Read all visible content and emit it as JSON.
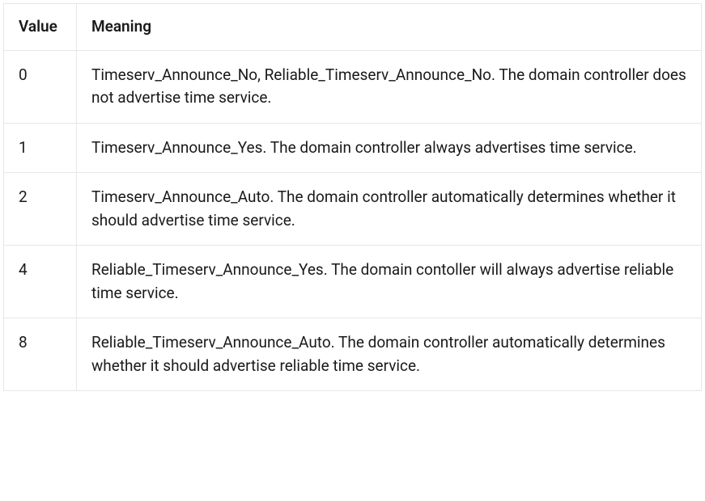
{
  "table": {
    "headers": {
      "value": "Value",
      "meaning": "Meaning"
    },
    "rows": [
      {
        "value": "0",
        "meaning": "Timeserv_Announce_No, Reliable_Timeserv_Announce_No. The domain controller does not advertise time service."
      },
      {
        "value": "1",
        "meaning": "Timeserv_Announce_Yes. The domain controller always advertises time service."
      },
      {
        "value": "2",
        "meaning": "Timeserv_Announce_Auto. The domain controller automatically determines whether it should advertise time service."
      },
      {
        "value": "4",
        "meaning": "Reliable_Timeserv_Announce_Yes. The domain contoller will always advertise reliable time service."
      },
      {
        "value": "8",
        "meaning": "Reliable_Timeserv_Announce_Auto. The domain controller automatically determines whether it should advertise reliable time service."
      }
    ]
  }
}
